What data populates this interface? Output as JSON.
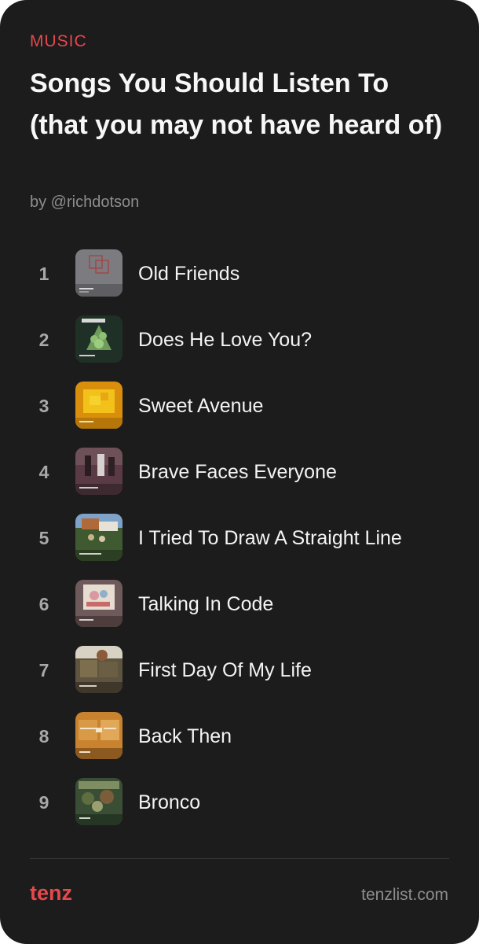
{
  "card": {
    "category": "MUSIC",
    "title": "Songs You Should Listen To (that you may not have heard of)",
    "author": "by @richdotson"
  },
  "songs": [
    {
      "rank": "1",
      "title": "Old Friends",
      "art": "album-art-icon"
    },
    {
      "rank": "2",
      "title": "Does He Love You?",
      "art": "album-art-icon"
    },
    {
      "rank": "3",
      "title": "Sweet Avenue",
      "art": "album-art-icon"
    },
    {
      "rank": "4",
      "title": "Brave Faces Everyone",
      "art": "album-art-icon"
    },
    {
      "rank": "5",
      "title": "I Tried To Draw A Straight Line",
      "art": "album-art-icon"
    },
    {
      "rank": "6",
      "title": "Talking In Code",
      "art": "album-art-icon"
    },
    {
      "rank": "7",
      "title": "First Day Of My Life",
      "art": "album-art-icon"
    },
    {
      "rank": "8",
      "title": "Back Then",
      "art": "album-art-icon"
    },
    {
      "rank": "9",
      "title": "Bronco",
      "art": "album-art-icon"
    }
  ],
  "footer": {
    "brand": "tenz",
    "site": "tenzlist.com"
  },
  "colors": {
    "background": "#1c1c1c",
    "accent": "#e5484d",
    "muted": "#8d8d8d",
    "rank": "#a8a8a8"
  }
}
